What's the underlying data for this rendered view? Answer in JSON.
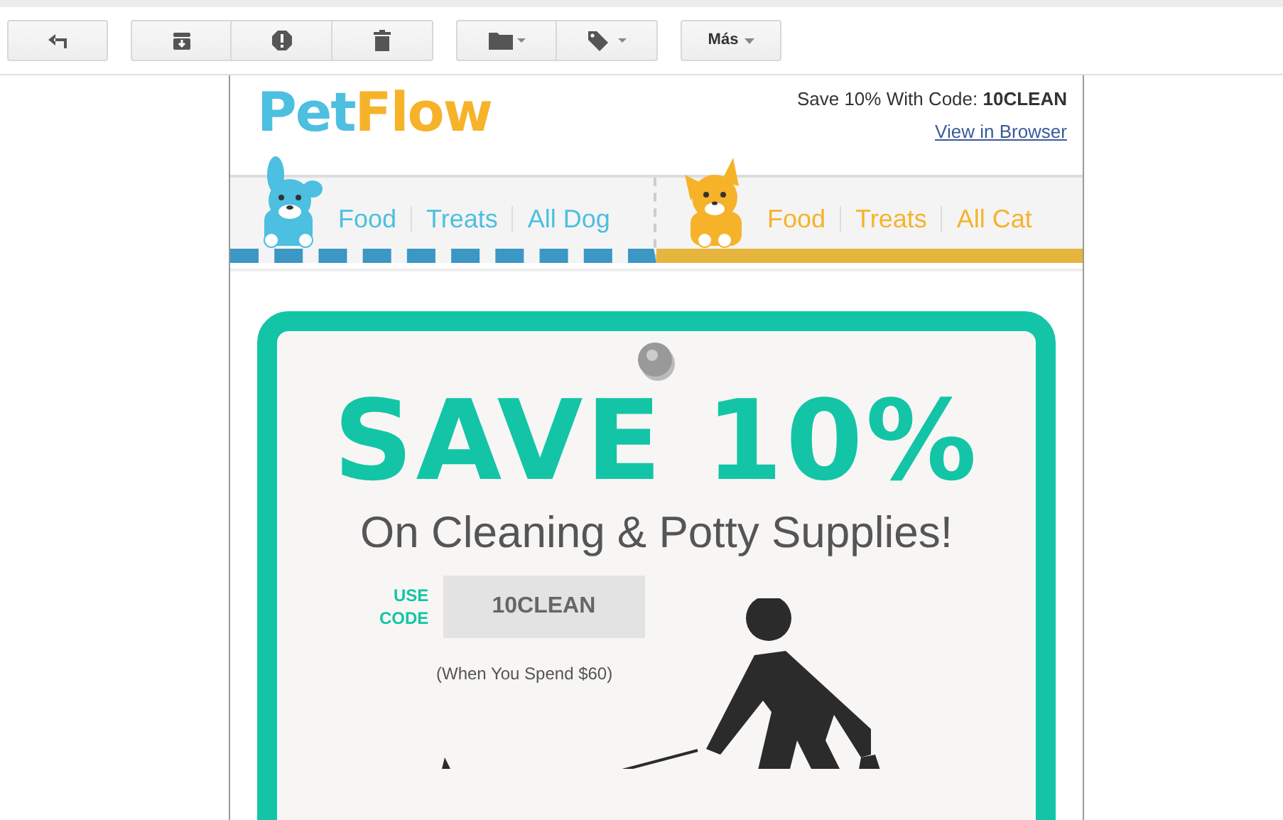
{
  "toolbar": {
    "groups": [
      [
        {
          "kind": "back"
        }
      ],
      [
        {
          "kind": "archive"
        },
        {
          "kind": "spam"
        },
        {
          "kind": "delete"
        }
      ],
      [
        {
          "kind": "folder"
        },
        {
          "kind": "label"
        }
      ],
      [
        {
          "kind": "more",
          "label": "Más"
        }
      ]
    ]
  },
  "email": {
    "logo": {
      "part_1": "Pet",
      "part_2": "Flow"
    },
    "promo_prefix": "Save 10% With Code: ",
    "promo_code": "10CLEAN",
    "view_link": "View in Browser",
    "nav": [
      {
        "kind": "dog",
        "links": [
          "Food",
          "Treats",
          "All Dog"
        ]
      },
      {
        "kind": "cat",
        "links": [
          "Food",
          "Treats",
          "All Cat"
        ]
      }
    ],
    "banner": {
      "headline": "SAVE 10%",
      "subtitle": "On Cleaning & Potty Supplies!",
      "use_code_label": [
        "USE",
        "CODE"
      ],
      "code": "10CLEAN",
      "condition": "(When You Spend $60)"
    }
  }
}
